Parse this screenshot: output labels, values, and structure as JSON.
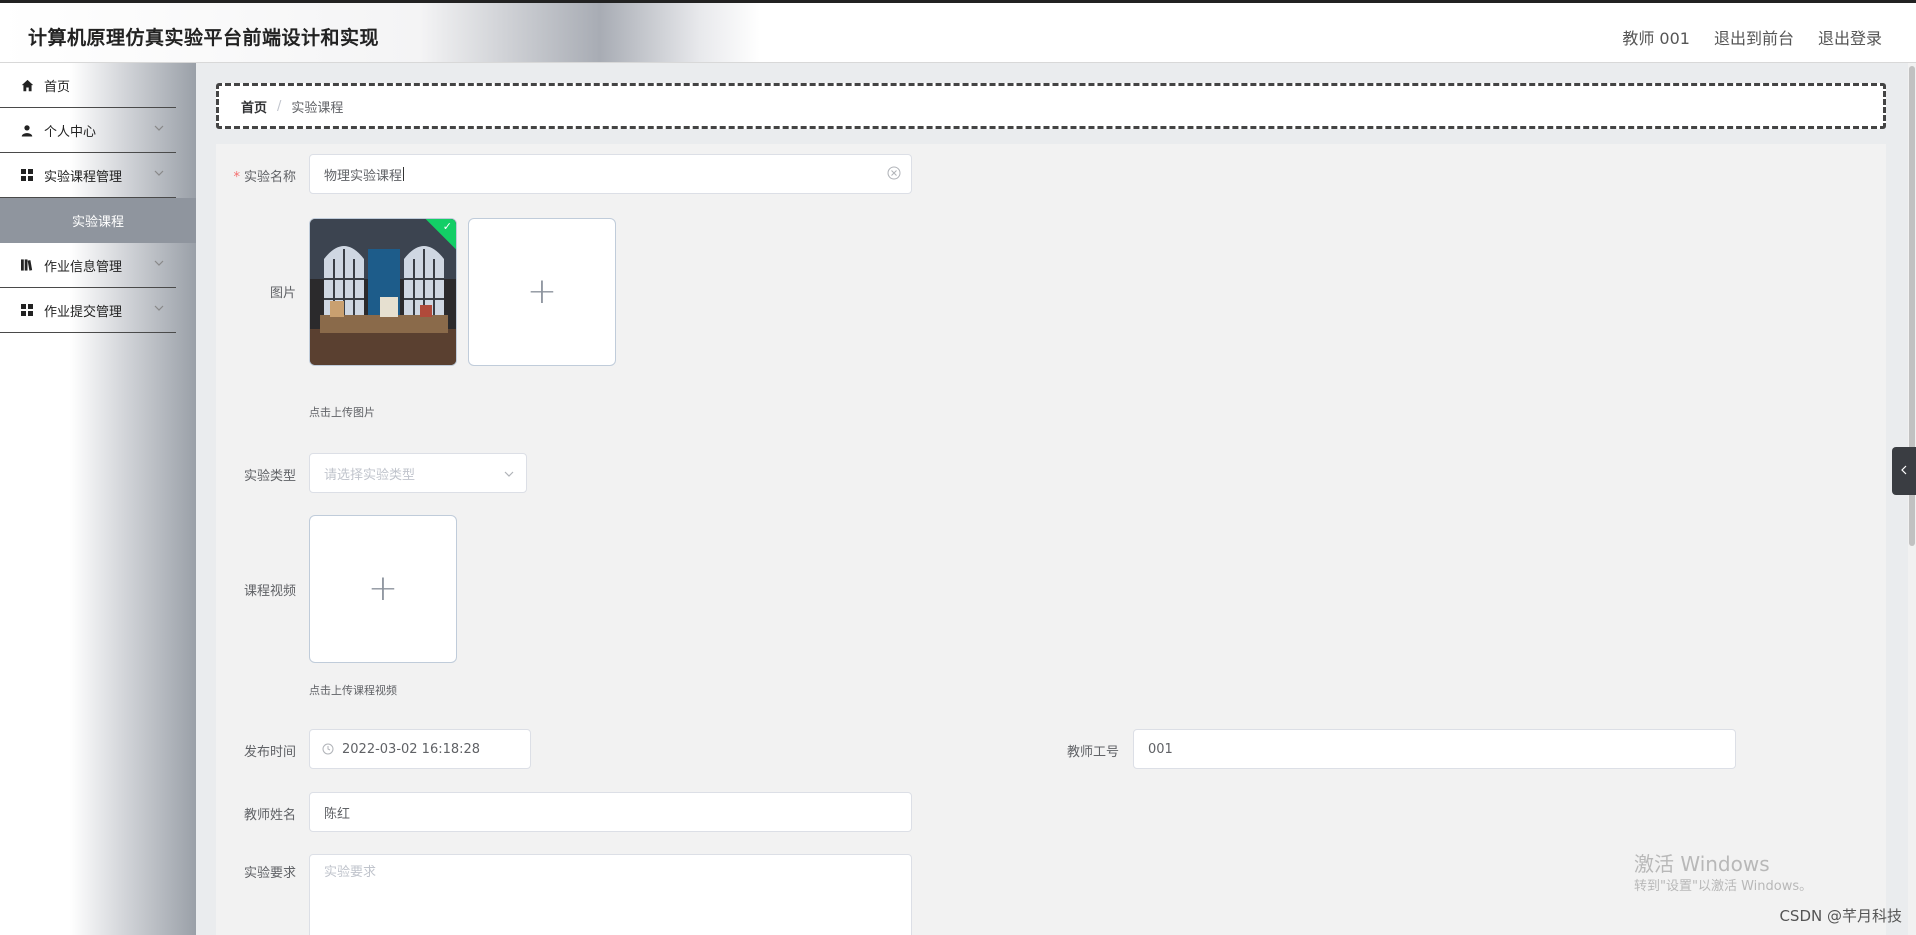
{
  "header": {
    "title": "计算机原理仿真实验平台前端设计和实现",
    "user": "教师 001",
    "to_front": "退出到前台",
    "logout": "退出登录"
  },
  "sidebar": {
    "items": [
      {
        "label": "首页",
        "icon": "home-icon"
      },
      {
        "label": "个人中心",
        "icon": "user-icon"
      },
      {
        "label": "实验课程管理",
        "icon": "grid-icon"
      },
      {
        "label": "作业信息管理",
        "icon": "book-icon"
      },
      {
        "label": "作业提交管理",
        "icon": "grid-icon"
      }
    ],
    "sub_item": "实验课程"
  },
  "breadcrumb": {
    "home": "首页",
    "separator": "/",
    "current": "实验课程"
  },
  "form": {
    "name_label": "实验名称",
    "name_required": "*",
    "name_value": "物理实验课程",
    "image_label": "图片",
    "image_tip": "点击上传图片",
    "type_label": "实验类型",
    "type_placeholder": "请选择实验类型",
    "video_label": "课程视频",
    "video_tip": "点击上传课程视频",
    "publish_label": "发布时间",
    "publish_value": "2022-03-02 16:18:28",
    "teacher_no_label": "教师工号",
    "teacher_no_value": "001",
    "teacher_name_label": "教师姓名",
    "teacher_name_value": "陈红",
    "requirement_label": "实验要求",
    "requirement_placeholder": "实验要求"
  },
  "watermark": {
    "line1": "激活 Windows",
    "line2": "转到\"设置\"以激活 Windows。",
    "csdn": "CSDN @芊月科技"
  },
  "colors": {
    "required": "#f56c6c",
    "success": "#13ce66",
    "sub_item_bg": "#8f959e"
  }
}
